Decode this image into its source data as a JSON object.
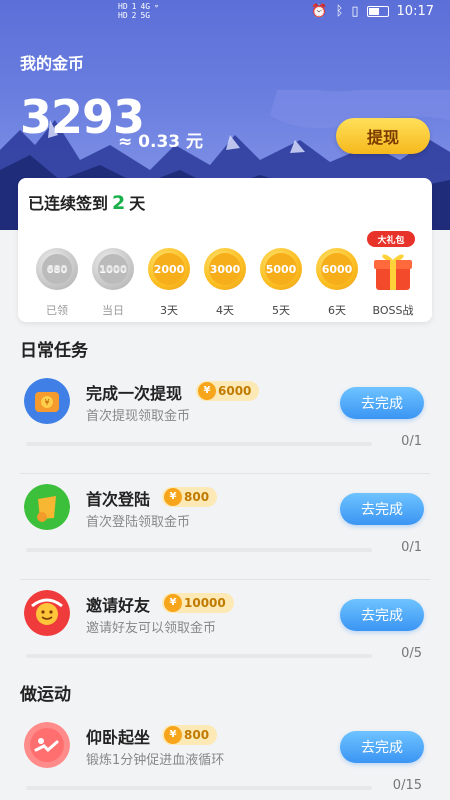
{
  "status": {
    "icons_left": [
      "HD",
      "1",
      "4G",
      "HD",
      "2",
      "5G"
    ],
    "time": "10:17"
  },
  "header": {
    "title": "我的金币",
    "coins": "3293",
    "approx": "≈ 0.33 元",
    "withdraw_label": "提现"
  },
  "checkin": {
    "prefix": "已连续签到",
    "days": "2",
    "suffix": "天",
    "days_list": [
      {
        "value": "680",
        "label": "已领",
        "state": "done"
      },
      {
        "value": "1000",
        "label": "当日",
        "state": "today"
      },
      {
        "value": "2000",
        "label": "3天",
        "state": "future"
      },
      {
        "value": "3000",
        "label": "4天",
        "state": "future"
      },
      {
        "value": "5000",
        "label": "5天",
        "state": "future"
      },
      {
        "value": "6000",
        "label": "6天",
        "state": "future"
      },
      {
        "value": "",
        "label": "BOSS战",
        "badge": "大礼包",
        "state": "gift"
      }
    ]
  },
  "sections": {
    "daily": "日常任务",
    "exercise": "做运动"
  },
  "tasks": [
    {
      "name": "完成一次提现",
      "reward": "6000",
      "desc": "首次提现领取金币",
      "button": "去完成",
      "progress": "0/1",
      "icon": "wallet-icon"
    },
    {
      "name": "首次登陆",
      "reward": "800",
      "desc": "首次登陆领取金币",
      "button": "去完成",
      "progress": "0/1",
      "icon": "login-icon"
    },
    {
      "name": "邀请好友",
      "reward": "10000",
      "desc": "邀请好友可以领取金币",
      "button": "去完成",
      "progress": "0/5",
      "icon": "invite-icon"
    },
    {
      "name": "仰卧起坐",
      "reward": "800",
      "desc": "锻炼1分钟促进血液循环",
      "button": "去完成",
      "progress": "0/15",
      "icon": "situp-icon"
    }
  ],
  "colors": {
    "accent": "#3b95f3",
    "gold": "#f7ae1b",
    "green": "#19b04a",
    "hero": "#5b6fd8"
  }
}
